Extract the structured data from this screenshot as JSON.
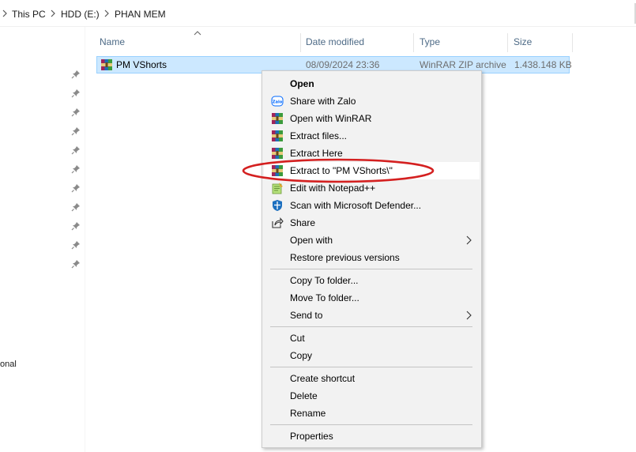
{
  "breadcrumb": {
    "items": [
      "This PC",
      "HDD (E:)",
      "PHAN MEM"
    ]
  },
  "nav": {
    "truncated_label": "onal"
  },
  "columns": {
    "name": "Name",
    "date": "Date modified",
    "type": "Type",
    "size": "Size"
  },
  "file": {
    "name": "PM VShorts",
    "date": "08/09/2024 23:36",
    "type": "WinRAR ZIP archive",
    "size": "1.438.148 KB",
    "icon": "winrar-archive-icon"
  },
  "context_menu": {
    "open": "Open",
    "share_zalo": "Share with Zalo",
    "zalo_icon_text": "Zalo",
    "open_winrar": "Open with WinRAR",
    "extract_files": "Extract files...",
    "extract_here": "Extract Here",
    "extract_to": "Extract to \"PM VShorts\\\"",
    "edit_notepad": "Edit with Notepad++",
    "scan_defender": "Scan with Microsoft Defender...",
    "share": "Share",
    "open_with": "Open with",
    "restore": "Restore previous versions",
    "copy_to": "Copy To folder...",
    "move_to": "Move To folder...",
    "send_to": "Send to",
    "cut": "Cut",
    "copy": "Copy",
    "create_shortcut": "Create shortcut",
    "delete": "Delete",
    "rename": "Rename",
    "properties": "Properties"
  },
  "colors": {
    "selection": "#cce8ff",
    "selection_border": "#99d1ff",
    "menu_bg": "#f2f2f2",
    "annotation": "#d42020",
    "header_text": "#4d6a86"
  }
}
